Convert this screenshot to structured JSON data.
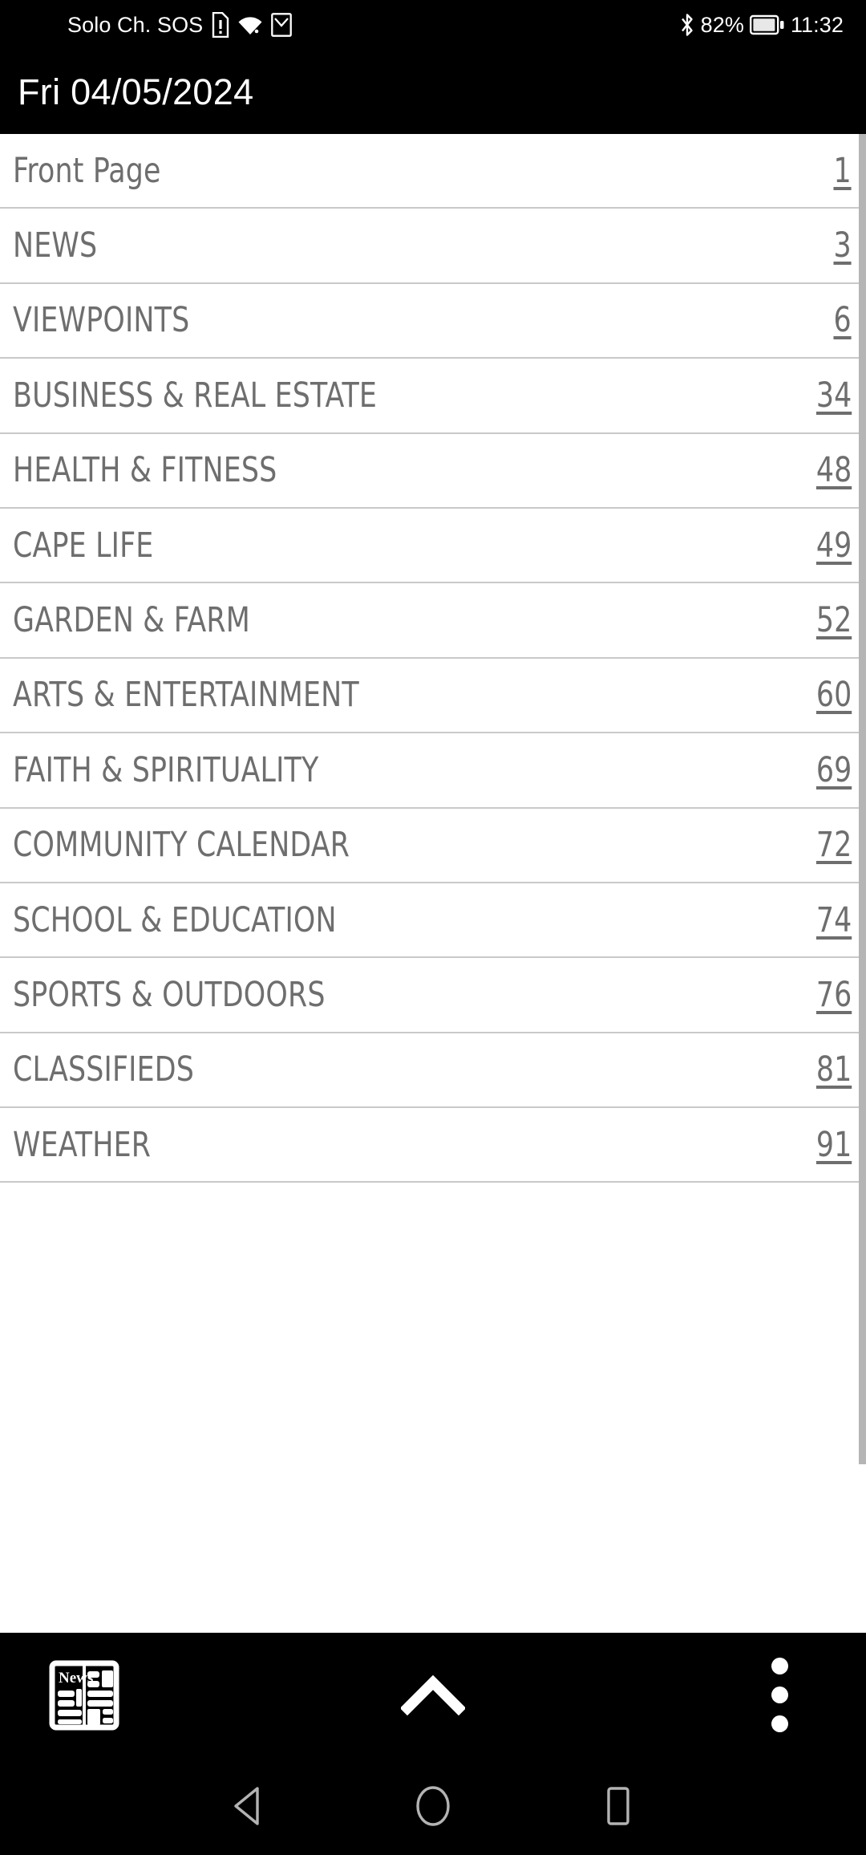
{
  "status_bar": {
    "carrier": "Solo Ch. SOS",
    "sim_icon": "sim-card-alert-icon",
    "wifi_icon": "wifi-icon",
    "mail_icon": "mail-icon",
    "bluetooth_icon": "bluetooth-icon",
    "battery_percent": "82%",
    "battery_icon": "battery-icon",
    "clock": "11:32"
  },
  "header": {
    "date": "Fri 04/05/2024"
  },
  "sections": [
    {
      "label": "Front Page",
      "page": "1",
      "style": "mixedcase"
    },
    {
      "label": "NEWS",
      "page": "3",
      "style": "upper"
    },
    {
      "label": "VIEWPOINTS",
      "page": "6",
      "style": "upper"
    },
    {
      "label": "BUSINESS & REAL ESTATE",
      "page": "34",
      "style": "upper"
    },
    {
      "label": "HEALTH & FITNESS",
      "page": "48",
      "style": "upper"
    },
    {
      "label": "CAPE LIFE",
      "page": "49",
      "style": "upper"
    },
    {
      "label": "GARDEN & FARM",
      "page": "52",
      "style": "upper"
    },
    {
      "label": "ARTS & ENTERTAINMENT",
      "page": "60",
      "style": "upper"
    },
    {
      "label": "FAITH & SPIRITUALITY",
      "page": "69",
      "style": "upper"
    },
    {
      "label": "COMMUNITY CALENDAR",
      "page": "72",
      "style": "upper"
    },
    {
      "label": "SCHOOL & EDUCATION",
      "page": "74",
      "style": "upper"
    },
    {
      "label": "SPORTS & OUTDOORS",
      "page": "76",
      "style": "upper"
    },
    {
      "label": "CLASSIFIEDS",
      "page": "81",
      "style": "upper"
    },
    {
      "label": "WEATHER",
      "page": "91",
      "style": "upper"
    }
  ],
  "toolbar": {
    "news_icon": "newspaper-icon",
    "news_masthead": "News",
    "up_icon": "chevron-up-icon",
    "more_icon": "overflow-menu-icon"
  },
  "nav_bar": {
    "back_icon": "back-triangle-icon",
    "home_icon": "home-circle-icon",
    "recents_icon": "recents-square-icon"
  },
  "colors": {
    "bar_background": "#000000",
    "list_background": "#ffffff",
    "text_gray": "#6e6e6e",
    "divider": "#c9c9c9",
    "scrollbar": "#b5b5b5"
  }
}
